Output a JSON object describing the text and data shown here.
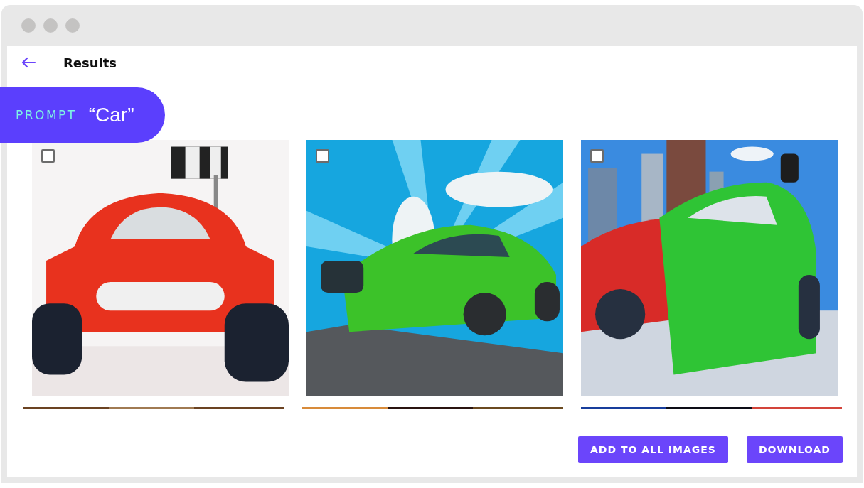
{
  "header": {
    "title": "Results"
  },
  "prompt": {
    "label": "PROMPT",
    "text": "“Car”"
  },
  "buttons": [
    "ADD TO ALL IMAGES",
    "DOWNLOAD"
  ]
}
